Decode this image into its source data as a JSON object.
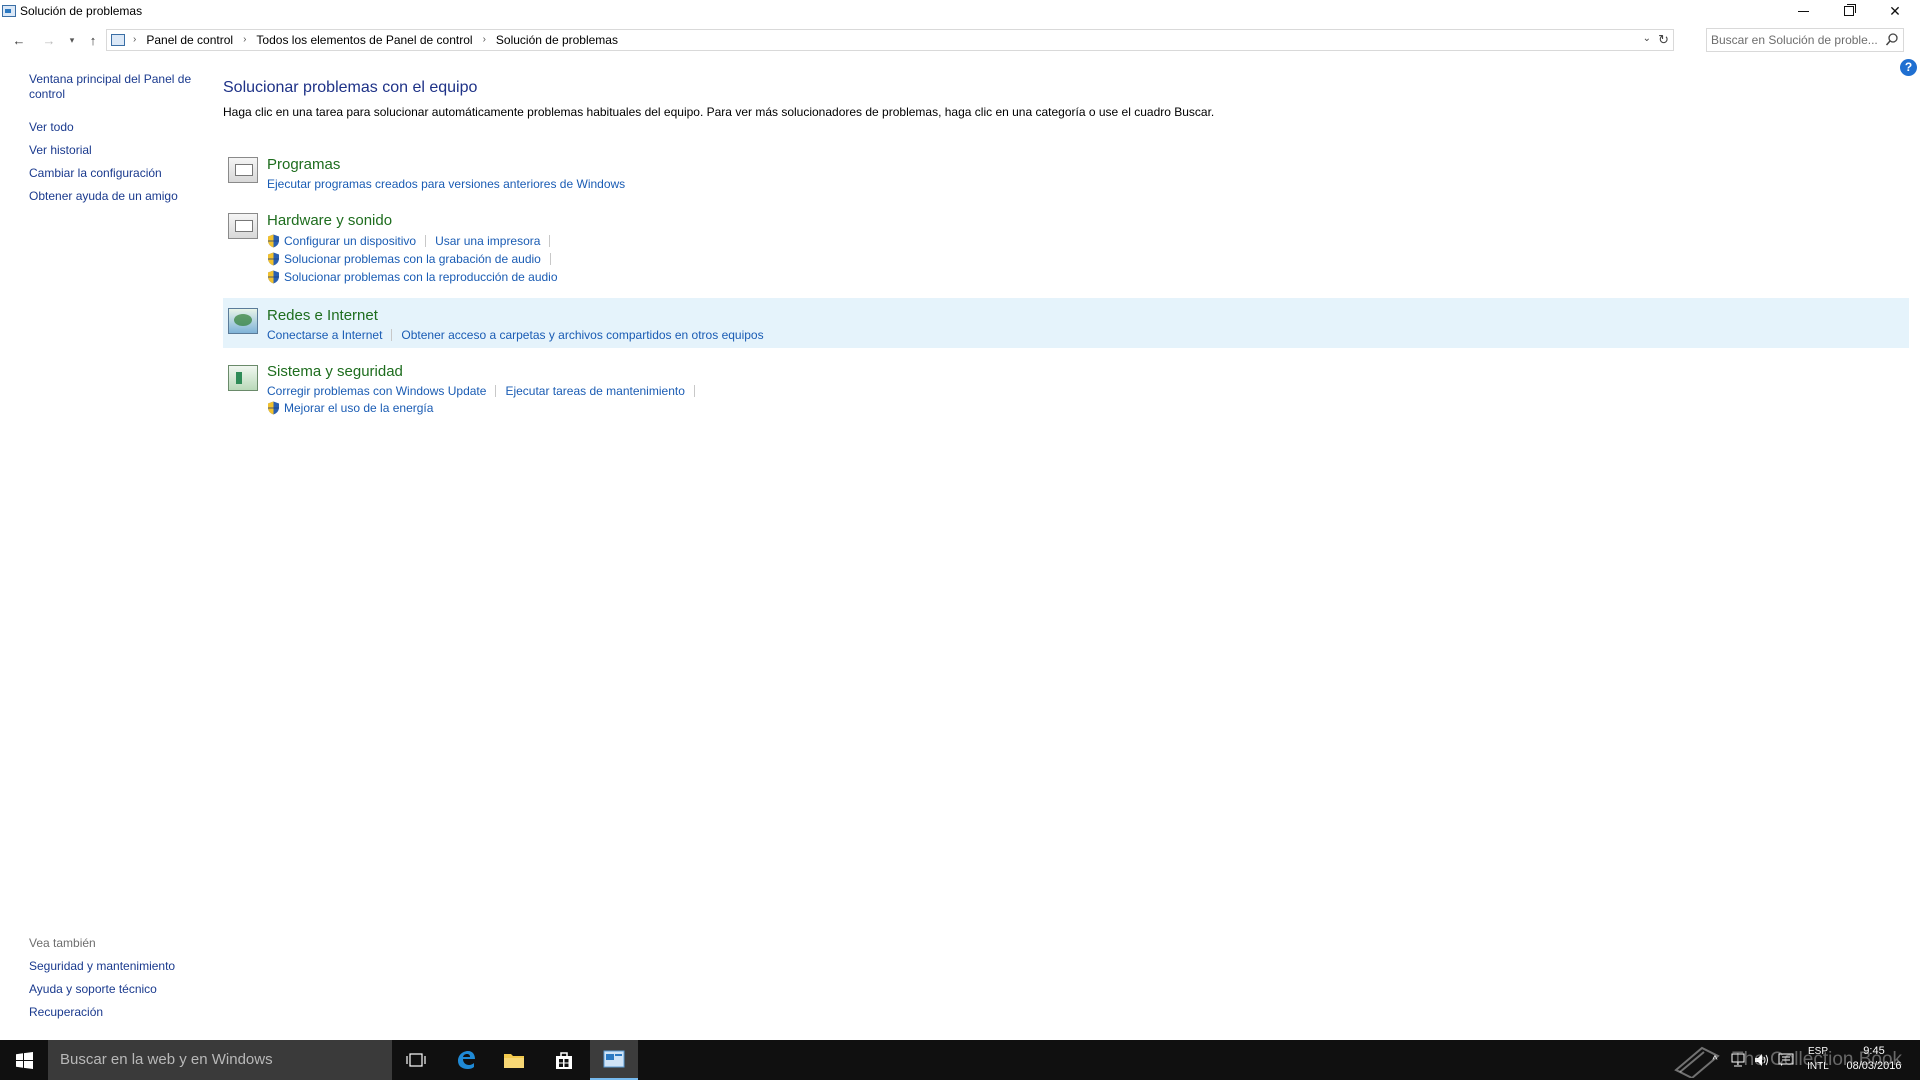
{
  "window": {
    "title": "Solución de problemas"
  },
  "nav": {
    "breadcrumbs": [
      "Panel de control",
      "Todos los elementos de Panel de control",
      "Solución de problemas"
    ],
    "search_placeholder": "Buscar en Solución de proble..."
  },
  "sidebar": {
    "links": [
      "Ventana principal del Panel de control",
      "Ver todo",
      "Ver historial",
      "Cambiar la configuración",
      "Obtener ayuda de un amigo"
    ],
    "see_also_heading": "Vea también",
    "see_also": [
      "Seguridad y mantenimiento",
      "Ayuda y soporte técnico",
      "Recuperación"
    ]
  },
  "main": {
    "title": "Solucionar problemas con el equipo",
    "description": "Haga clic en una tarea para solucionar automáticamente problemas habituales del equipo. Para ver más solucionadores de problemas, haga clic en una categoría o use el cuadro Buscar.",
    "categories": [
      {
        "title": "Programas",
        "icon": "programs-icon",
        "rows": [
          [
            {
              "label": "Ejecutar programas creados para versiones anteriores de Windows",
              "shield": false
            }
          ]
        ]
      },
      {
        "title": "Hardware y sonido",
        "icon": "hardware-icon",
        "rows": [
          [
            {
              "label": "Configurar un dispositivo",
              "shield": true
            },
            {
              "label": "Usar una impresora",
              "shield": false
            }
          ],
          [
            {
              "label": "Solucionar problemas con la grabación de audio",
              "shield": true
            }
          ],
          [
            {
              "label": "Solucionar problemas con la reproducción de audio",
              "shield": true
            }
          ]
        ]
      },
      {
        "title": "Redes e Internet",
        "icon": "network-icon",
        "rows": [
          [
            {
              "label": "Conectarse a Internet",
              "shield": false
            },
            {
              "label": "Obtener acceso a carpetas y archivos compartidos en otros equipos",
              "shield": false
            }
          ]
        ]
      },
      {
        "title": "Sistema y seguridad",
        "icon": "system-icon",
        "rows": [
          [
            {
              "label": "Corregir problemas con Windows Update",
              "shield": false
            },
            {
              "label": "Ejecutar tareas de mantenimiento",
              "shield": false
            }
          ],
          [
            {
              "label": "Mejorar el uso de la energía",
              "shield": true
            }
          ]
        ]
      }
    ]
  },
  "taskbar": {
    "search_placeholder": "Buscar en la web y en Windows",
    "lang_top": "ESP",
    "lang_bottom": "INTL",
    "time": "9:45",
    "date": "08/03/2016"
  },
  "watermark": "The Collection Book",
  "colors": {
    "link": "#1a5cb4",
    "category_title": "#1e6d1e",
    "page_title": "#1e3287",
    "highlight": "#e5f3fb",
    "taskbar": "#101010"
  }
}
